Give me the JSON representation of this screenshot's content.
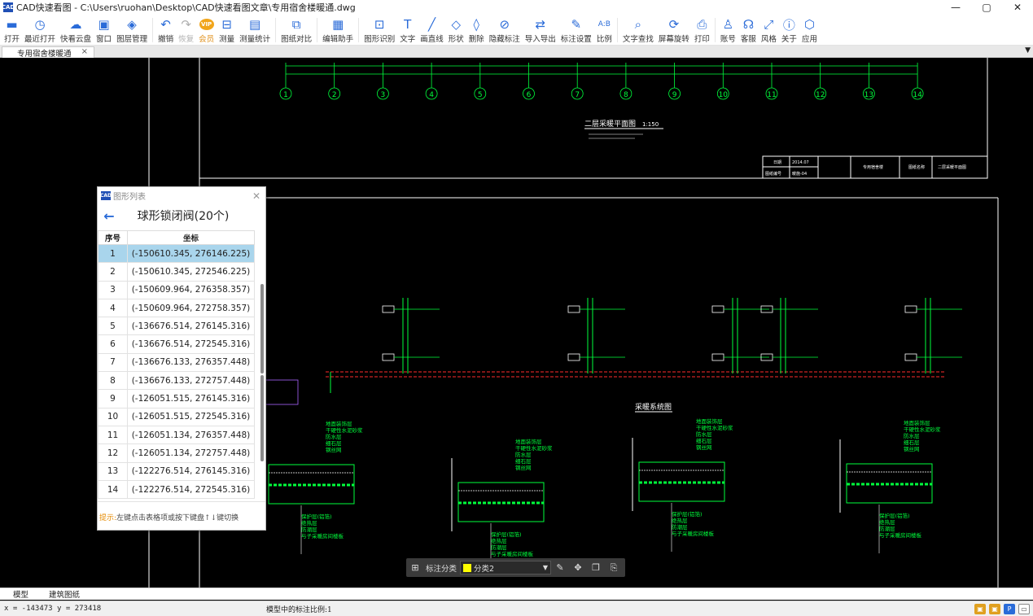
{
  "window": {
    "app_title": "CAD快速看图 - C:\\Users\\ruohan\\Desktop\\CAD快速看图文章\\专用宿舍楼暖通.dwg",
    "controls": [
      "—",
      "▢",
      "✕"
    ]
  },
  "toolbar": {
    "items": [
      {
        "label": "打开",
        "icon": "folder-icon"
      },
      {
        "label": "最近打开",
        "icon": "clock-icon"
      },
      {
        "label": "快看云盘",
        "icon": "cloud-icon"
      },
      {
        "label": "窗口",
        "icon": "window-icon"
      },
      {
        "label": "图层管理",
        "icon": "layers-icon"
      },
      {
        "label": "撤销",
        "icon": "undo-icon"
      },
      {
        "label": "恢复",
        "icon": "redo-icon"
      },
      {
        "label": "会员",
        "icon": "vip-icon"
      },
      {
        "label": "测量",
        "icon": "ruler-icon"
      },
      {
        "label": "测量统计",
        "icon": "measure-stats-icon"
      },
      {
        "label": "图纸对比",
        "icon": "compare-icon"
      },
      {
        "label": "编辑助手",
        "icon": "edit-assistant-icon"
      },
      {
        "label": "图形识别",
        "icon": "shape-recognition-icon"
      },
      {
        "label": "文字",
        "icon": "text-icon"
      },
      {
        "label": "画直线",
        "icon": "line-icon"
      },
      {
        "label": "形状",
        "icon": "shape-icon"
      },
      {
        "label": "删除",
        "icon": "eraser-icon"
      },
      {
        "label": "隐藏标注",
        "icon": "hide-annotation-icon"
      },
      {
        "label": "导入导出",
        "icon": "import-export-icon"
      },
      {
        "label": "标注设置",
        "icon": "annotation-settings-icon"
      },
      {
        "label": "比例",
        "icon": "scale-icon"
      },
      {
        "label": "文字查找",
        "icon": "text-search-icon"
      },
      {
        "label": "屏幕旋转",
        "icon": "rotate-screen-icon"
      },
      {
        "label": "打印",
        "icon": "print-icon"
      },
      {
        "label": "账号",
        "icon": "user-icon"
      },
      {
        "label": "客服",
        "icon": "headset-icon"
      },
      {
        "label": "风格",
        "icon": "style-icon"
      },
      {
        "label": "关于",
        "icon": "info-icon"
      },
      {
        "label": "应用",
        "icon": "apps-icon"
      }
    ],
    "vip_badge": "VIP"
  },
  "tabs": {
    "active_doc": "专用宿舍楼暖通",
    "close_glyph": "×"
  },
  "panel": {
    "header": "图形列表",
    "title": "球形锁闭阀(20个)",
    "col_index": "序号",
    "col_coord": "坐标",
    "rows": [
      {
        "n": "1",
        "coord": "(-150610.345, 276146.225)"
      },
      {
        "n": "2",
        "coord": "(-150610.345, 272546.225)"
      },
      {
        "n": "3",
        "coord": "(-150609.964, 276358.357)"
      },
      {
        "n": "4",
        "coord": "(-150609.964, 272758.357)"
      },
      {
        "n": "5",
        "coord": "(-136676.514, 276145.316)"
      },
      {
        "n": "6",
        "coord": "(-136676.514, 272545.316)"
      },
      {
        "n": "7",
        "coord": "(-136676.133, 276357.448)"
      },
      {
        "n": "8",
        "coord": "(-136676.133, 272757.448)"
      },
      {
        "n": "9",
        "coord": "(-126051.515, 276145.316)"
      },
      {
        "n": "10",
        "coord": "(-126051.515, 272545.316)"
      },
      {
        "n": "11",
        "coord": "(-126051.134, 276357.448)"
      },
      {
        "n": "12",
        "coord": "(-126051.134, 272757.448)"
      },
      {
        "n": "13",
        "coord": "(-122276.514, 276145.316)"
      },
      {
        "n": "14",
        "coord": "(-122276.514, 272545.316)"
      }
    ],
    "hint_prefix": "提示:",
    "hint_text": "左键点击表格项或按下键盘↑↓键切换"
  },
  "annotation_bar": {
    "label": "标注分类",
    "selected": "分类2",
    "swatch_color": "#ffff00"
  },
  "drawing": {
    "grid_numbers": [
      "1",
      "2",
      "3",
      "4",
      "5",
      "6",
      "7",
      "8",
      "9",
      "10",
      "11",
      "12",
      "13",
      "14"
    ],
    "plan_title": "二层采暖平面图",
    "plan_scale": "1:150",
    "system_title": "采暖系统图",
    "titleblock": {
      "date_label": "日期",
      "date_value": "2014.07",
      "drawing_no_label": "图纸编号",
      "drawing_no_value": "暖施-04",
      "project": "专用宿舍楼",
      "drawing_name_label": "图纸名称",
      "drawing_name": "二层采暖平面图"
    },
    "legend_labels": [
      "地面装饰层",
      "干硬性水泥砂浆",
      "防水层",
      "细石层",
      "钢丝网"
    ],
    "detail_labels": [
      "保护层(铝箔)",
      "绝热层",
      "防潮层",
      "与子采暖房间楼板"
    ],
    "colors": {
      "green": "#00ff3c",
      "red": "#ff2b2b",
      "white": "#ffffff",
      "yellow": "#ffff00"
    }
  },
  "layout_tabs": [
    "模型",
    "建筑图纸"
  ],
  "status": {
    "coords": "x = -143473  y = 273418",
    "scale_text": "模型中的标注比例:1"
  }
}
